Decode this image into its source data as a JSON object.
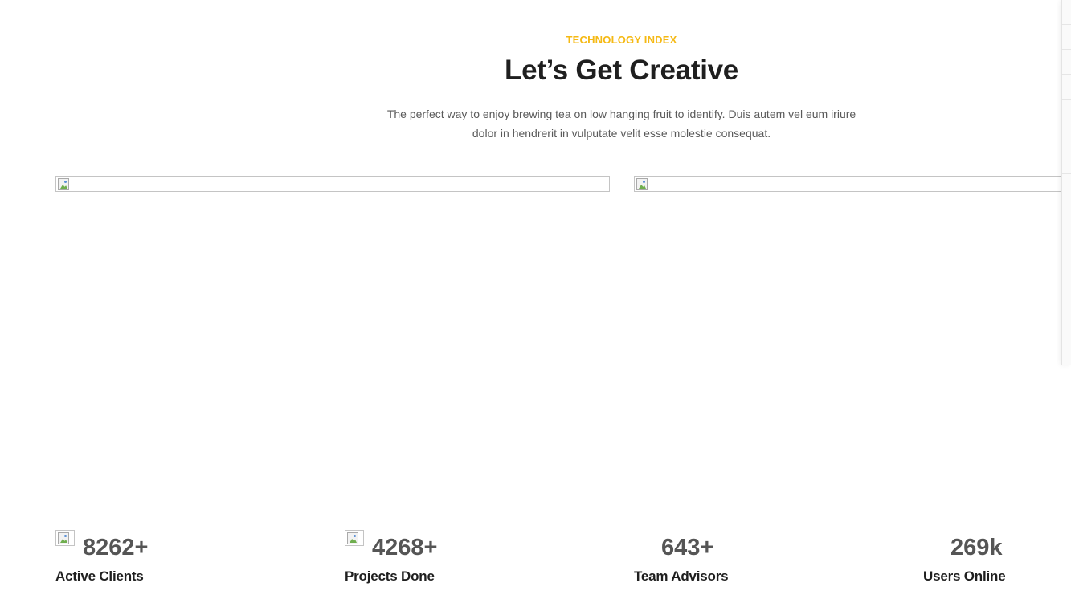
{
  "section": {
    "eyebrow": "TECHNOLOGY INDEX",
    "title": "Let’s Get Creative",
    "description_line1": "The perfect way to enjoy brewing tea on low hanging fruit to identify. Duis autem vel eum iriure",
    "description_line2": "dolor in hendrerit in vulputate velit esse molestie consequat."
  },
  "images": [
    {
      "icon": "broken-image-icon"
    },
    {
      "icon": "broken-image-icon"
    }
  ],
  "stats": [
    {
      "number": "8262+",
      "label": "Active Clients",
      "icon": "broken-image-icon"
    },
    {
      "number": "4268+",
      "label": "Projects Done",
      "icon": "broken-image-icon"
    },
    {
      "number": "643+",
      "label": "Team Advisors"
    },
    {
      "number": "269k",
      "label": "Users Online"
    }
  ],
  "colors": {
    "accent": "#f5b914",
    "heading": "#1f1f1f",
    "body_text": "#5a5a5a",
    "stat_number": "#555555"
  }
}
